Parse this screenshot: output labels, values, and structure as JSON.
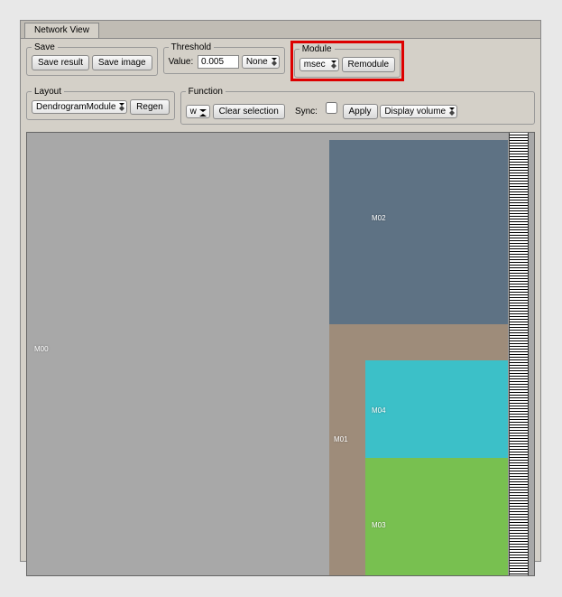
{
  "tab": {
    "label": "Network View"
  },
  "save": {
    "legend": "Save",
    "result_btn": "Save result",
    "image_btn": "Save image"
  },
  "threshold": {
    "legend": "Threshold",
    "value_label": "Value:",
    "value": "0.005",
    "method": "None"
  },
  "module": {
    "legend": "Module",
    "name": "msec",
    "remodule_btn": "Remodule"
  },
  "layout": {
    "legend": "Layout",
    "mode": "DendrogramModule",
    "regen_btn": "Regen"
  },
  "function": {
    "legend": "Function",
    "var": "w",
    "clear_btn": "Clear selection",
    "sync_label": "Sync:",
    "apply_btn": "Apply",
    "display": "Display volume"
  },
  "blocks": {
    "m00": "M00",
    "m01": "M01",
    "m02": "M02",
    "m03": "M03",
    "m04": "M04"
  }
}
